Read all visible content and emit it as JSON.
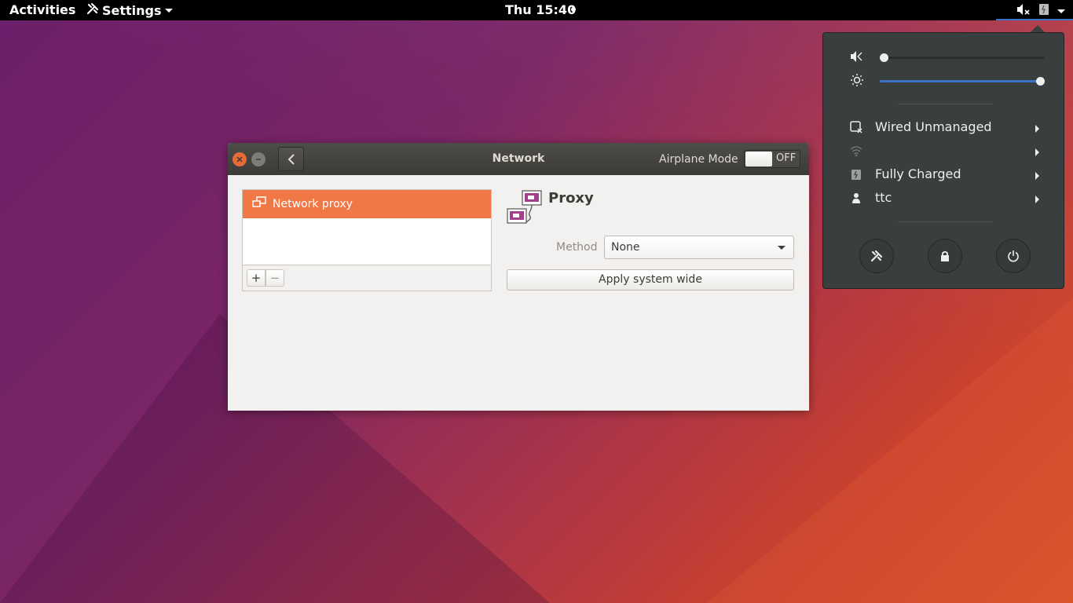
{
  "topbar": {
    "activities": "Activities",
    "app_menu": "Settings",
    "clock": "Thu 15:40"
  },
  "window": {
    "title": "Network",
    "airplane_mode_label": "Airplane Mode",
    "airplane_mode_state": "OFF",
    "sidebar": {
      "items": [
        {
          "label": "Network proxy",
          "selected": true
        }
      ],
      "add_label": "+",
      "remove_label": "−"
    },
    "proxy": {
      "title": "Proxy",
      "method_label": "Method",
      "method_value": "None",
      "apply_label": "Apply system wide"
    }
  },
  "system_menu": {
    "volume": {
      "icon": "volume-muted-icon",
      "level": 0.0
    },
    "brightness": {
      "icon": "brightness-icon",
      "level": 1.0
    },
    "rows": [
      {
        "icon": "wired-network-icon",
        "label": "Wired Unmanaged"
      },
      {
        "icon": "wifi-icon",
        "label": ""
      },
      {
        "icon": "battery-icon",
        "label": "Fully Charged"
      },
      {
        "icon": "user-icon",
        "label": "ttc"
      }
    ],
    "buttons": [
      "settings-icon",
      "lock-icon",
      "power-icon"
    ]
  },
  "colors": {
    "accent": "#f07746",
    "slider_blue": "#3c74c8",
    "menu_bg": "#393f3f",
    "titlebar": "#3c3b37"
  }
}
